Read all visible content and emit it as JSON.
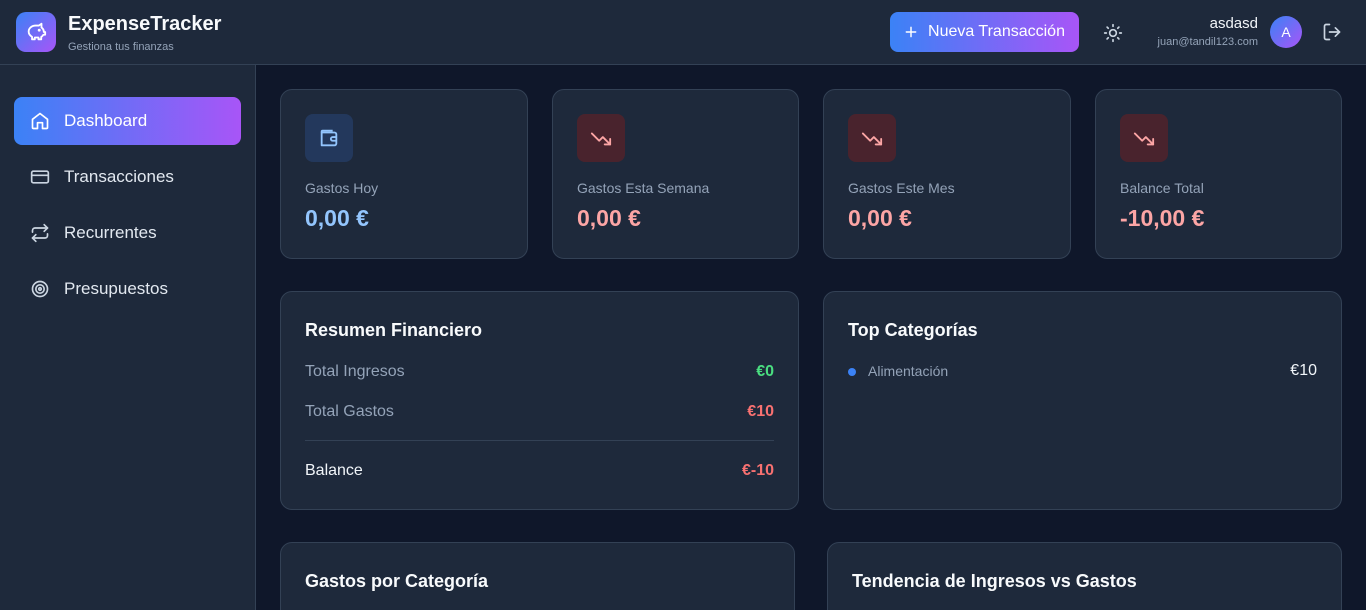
{
  "header": {
    "app_title": "ExpenseTracker",
    "app_subtitle": "Gestiona tus finanzas",
    "new_transaction_label": "Nueva Transacción",
    "user_name": "asdasd",
    "user_email": "juan@tandil123.com",
    "avatar_initial": "A"
  },
  "sidebar": {
    "items": [
      {
        "label": "Dashboard",
        "icon": "home-icon",
        "active": true
      },
      {
        "label": "Transacciones",
        "icon": "credit-card-icon",
        "active": false
      },
      {
        "label": "Recurrentes",
        "icon": "repeat-icon",
        "active": false
      },
      {
        "label": "Presupuestos",
        "icon": "target-icon",
        "active": false
      }
    ]
  },
  "stats": [
    {
      "label": "Gastos Hoy",
      "value": "0,00 €",
      "icon": "wallet-icon",
      "tone": "blue"
    },
    {
      "label": "Gastos Esta Semana",
      "value": "0,00 €",
      "icon": "trending-down-icon",
      "tone": "red"
    },
    {
      "label": "Gastos Este Mes",
      "value": "0,00 €",
      "icon": "trending-down-icon",
      "tone": "red"
    },
    {
      "label": "Balance Total",
      "value": "-10,00 €",
      "icon": "trending-down-icon",
      "tone": "red"
    }
  ],
  "summary": {
    "title": "Resumen Financiero",
    "income_label": "Total Ingresos",
    "income_value": "€0",
    "expense_label": "Total Gastos",
    "expense_value": "€10",
    "balance_label": "Balance",
    "balance_value": "€-10"
  },
  "top_categories": {
    "title": "Top Categorías",
    "items": [
      {
        "name": "Alimentación",
        "value": "€10",
        "color": "#3b82f6"
      }
    ]
  },
  "charts": {
    "by_category_title": "Gastos por Categoría",
    "trend_title": "Tendencia de Ingresos vs Gastos"
  },
  "colors": {
    "accent_start": "#3b82f6",
    "accent_end": "#a855f7",
    "positive": "#4ade80",
    "negative": "#f87171"
  }
}
